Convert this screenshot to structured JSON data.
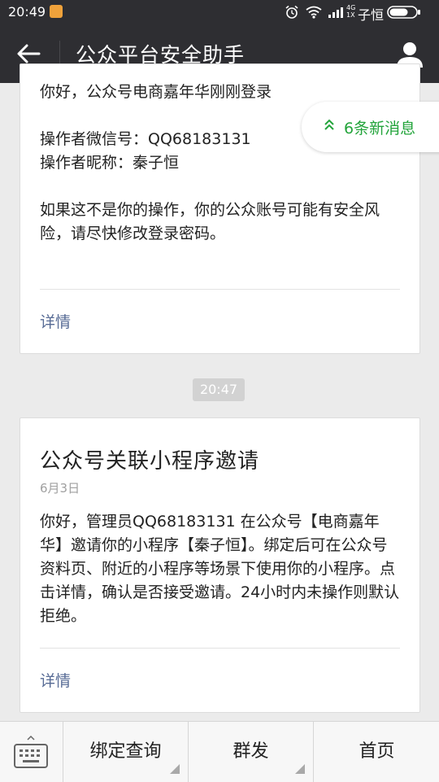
{
  "status_bar": {
    "time": "20:49",
    "network": "4G",
    "network_sub": "1X",
    "carrier": "子恒"
  },
  "title_bar": {
    "title": "公众平台安全助手"
  },
  "card1": {
    "greeting": "你好，公众号电商嘉年华刚刚登录",
    "operator_lines": "操作者微信号：QQ68183131\n操作者昵称：秦子恒",
    "warning": "如果这不是你的操作，你的公众账号可能有安全风险，请尽快修改登录密码。",
    "detail_label": "详情"
  },
  "new_messages": {
    "label": "6条新消息"
  },
  "timestamp": "20:47",
  "card2": {
    "title": "公众号关联小程序邀请",
    "date": "6月3日",
    "body": "你好，管理员QQ68183131 在公众号【电商嘉年华】邀请你的小程序【秦子恒】。绑定后可在公众号资料页、附近的小程序等场景下使用你的小程序。点击详情，确认是否接受邀请。24小时内未操作则默认拒绝。",
    "detail_label": "详情"
  },
  "bottom_menu": {
    "items": [
      {
        "label": "绑定查询"
      },
      {
        "label": "群发"
      },
      {
        "label": "首页"
      }
    ]
  },
  "colors": {
    "header_bg": "#2e2e32",
    "link": "#576b95",
    "new_msg_green": "#23a43b"
  }
}
